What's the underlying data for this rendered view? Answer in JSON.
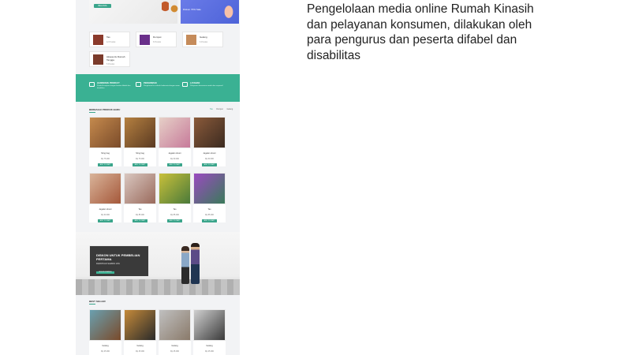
{
  "description": "Pengelolaan media online Rumah Kinasih dan pelayanan konsumen, dilakukan oleh para pengurus dan peserta difabel dan disabilitas",
  "colors": {
    "accent": "#3aa58b",
    "band": "#3ab193",
    "promo_dark": "#3a3a3a",
    "hero_blue": "#5066dd"
  },
  "hero": {
    "button_label": "BELANJA",
    "right_text": "Diskon 70% Sale"
  },
  "categories": [
    {
      "title": "Tas",
      "subtitle": "12 Produk",
      "thumb": "#8b3a2b"
    },
    {
      "title": "Dompet",
      "subtitle": "8 Produk",
      "thumb": "#6a2f8a"
    },
    {
      "title": "Gelang",
      "subtitle": "6 Produk",
      "thumb": "#c58b5a"
    },
    {
      "title": "Aksesoris Rumah Tangga",
      "subtitle": "5 Produk",
      "thumb": "#7b3b2b"
    }
  ],
  "features": [
    {
      "icon": "leaf-icon",
      "title": "HANDMADE PRODUCT",
      "text": "Produk kerajinan tangan buatan difabel dan disabilitas"
    },
    {
      "icon": "truck-icon",
      "title": "PENGIRIMAN",
      "text": "Pengiriman ke seluruh Indonesia dengan aman"
    },
    {
      "icon": "chat-icon",
      "title": "LAYANAN",
      "text": "Pelayanan konsumen ramah dan responsif"
    }
  ],
  "new_products": {
    "title": "BERBAGAI PRODUK BARU",
    "tabs": [
      "Tas",
      "Dompet",
      "Gelang"
    ],
    "items": [
      {
        "name": "Sling bag",
        "price": "Rp 75.000",
        "cart": "ADD TO CART",
        "img1": "#7a4b2a",
        "img2": "#c58a4d"
      },
      {
        "name": "Sling bag",
        "price": "Rp 75.000",
        "cart": "ADD TO CART",
        "img1": "#5a3a22",
        "img2": "#b58040"
      },
      {
        "name": "Jagalan dresri",
        "price": "Rp 60.000",
        "cart": "ADD TO CART",
        "img1": "#c77a9a",
        "img2": "#e6d0c7"
      },
      {
        "name": "Jagalan dresri",
        "price": "Rp 60.000",
        "cart": "ADD TO CART",
        "img1": "#3b2a20",
        "img2": "#8a5a3a"
      },
      {
        "name": "Jagalan dresri",
        "price": "Rp 60.000",
        "cart": "ADD TO CART",
        "img1": "#a5583a",
        "img2": "#d9b49a"
      },
      {
        "name": "Tas",
        "price": "Rp 85.000",
        "cart": "ADD TO CART",
        "img1": "#d9c7c0",
        "img2": "#9a6a5c"
      },
      {
        "name": "Tas",
        "price": "Rp 85.000",
        "cart": "ADD TO CART",
        "img1": "#4a7a3a",
        "img2": "#c9c03a"
      },
      {
        "name": "Tas",
        "price": "Rp 85.000",
        "cart": "ADD TO CART",
        "img1": "#3a7a5a",
        "img2": "#9a4ac0"
      }
    ]
  },
  "promo": {
    "title": "DISKON UNTUK PEMBELIAN PERTAMA",
    "subtitle": "DAPATKAN SAMPAI 10%",
    "button": "BELANJA SEKARANG"
  },
  "best_seller": {
    "title": "BEST SELLER",
    "items": [
      {
        "name": "Gelang",
        "price": "Rp 25.000",
        "img1": "#6aa0b0",
        "img2": "#7a4a2a"
      },
      {
        "name": "Gelang",
        "price": "Rp 25.000",
        "img1": "#2a2a2a",
        "img2": "#c58a3a"
      },
      {
        "name": "Gelang",
        "price": "Rp 25.000",
        "img1": "#8a7a6a",
        "img2": "#c0c0c0"
      },
      {
        "name": "Gelang",
        "price": "Rp 25.000",
        "img1": "#d0d0d0",
        "img2": "#3a3a3a"
      }
    ]
  }
}
